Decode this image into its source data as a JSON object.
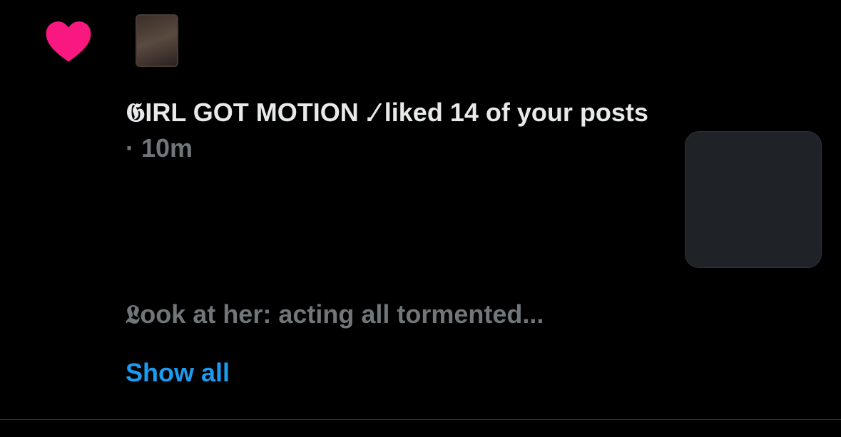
{
  "notification": {
    "actor_name": "𝕲IRL GOT MOTION .⁄",
    "action_text": " liked 14 of your posts",
    "separator": " · ",
    "timestamp": "10m",
    "preview_text": "𝕷ook at her: acting all tormented...",
    "show_all_label": "Show all"
  },
  "colors": {
    "background": "#000000",
    "heart": "#f91880",
    "primary_text": "#e7e9ea",
    "secondary_text": "#71767b",
    "link": "#1d9bf0"
  },
  "icons": {
    "type_icon": "heart-icon"
  }
}
